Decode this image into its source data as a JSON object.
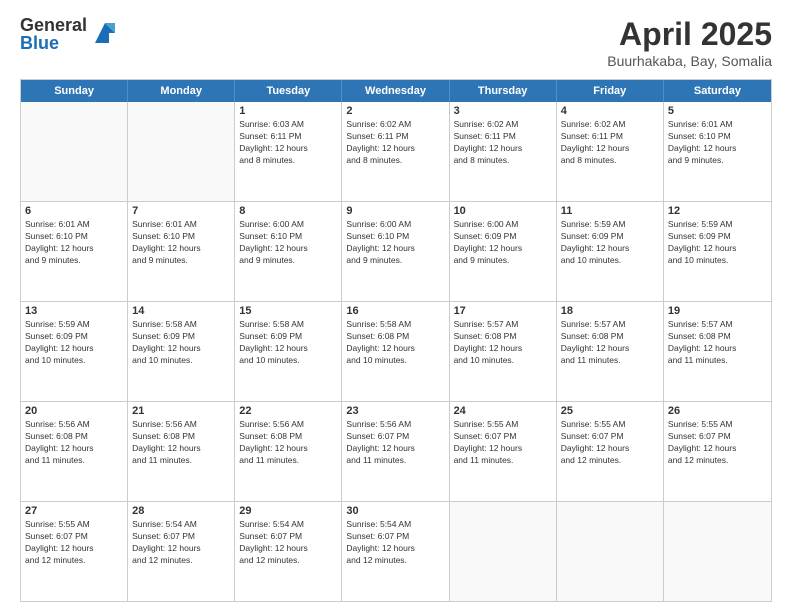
{
  "logo": {
    "general": "General",
    "blue": "Blue"
  },
  "title": "April 2025",
  "subtitle": "Buurhakaba, Bay, Somalia",
  "header_days": [
    "Sunday",
    "Monday",
    "Tuesday",
    "Wednesday",
    "Thursday",
    "Friday",
    "Saturday"
  ],
  "rows": [
    [
      {
        "day": "",
        "lines": []
      },
      {
        "day": "",
        "lines": []
      },
      {
        "day": "1",
        "lines": [
          "Sunrise: 6:03 AM",
          "Sunset: 6:11 PM",
          "Daylight: 12 hours",
          "and 8 minutes."
        ]
      },
      {
        "day": "2",
        "lines": [
          "Sunrise: 6:02 AM",
          "Sunset: 6:11 PM",
          "Daylight: 12 hours",
          "and 8 minutes."
        ]
      },
      {
        "day": "3",
        "lines": [
          "Sunrise: 6:02 AM",
          "Sunset: 6:11 PM",
          "Daylight: 12 hours",
          "and 8 minutes."
        ]
      },
      {
        "day": "4",
        "lines": [
          "Sunrise: 6:02 AM",
          "Sunset: 6:11 PM",
          "Daylight: 12 hours",
          "and 8 minutes."
        ]
      },
      {
        "day": "5",
        "lines": [
          "Sunrise: 6:01 AM",
          "Sunset: 6:10 PM",
          "Daylight: 12 hours",
          "and 9 minutes."
        ]
      }
    ],
    [
      {
        "day": "6",
        "lines": [
          "Sunrise: 6:01 AM",
          "Sunset: 6:10 PM",
          "Daylight: 12 hours",
          "and 9 minutes."
        ]
      },
      {
        "day": "7",
        "lines": [
          "Sunrise: 6:01 AM",
          "Sunset: 6:10 PM",
          "Daylight: 12 hours",
          "and 9 minutes."
        ]
      },
      {
        "day": "8",
        "lines": [
          "Sunrise: 6:00 AM",
          "Sunset: 6:10 PM",
          "Daylight: 12 hours",
          "and 9 minutes."
        ]
      },
      {
        "day": "9",
        "lines": [
          "Sunrise: 6:00 AM",
          "Sunset: 6:10 PM",
          "Daylight: 12 hours",
          "and 9 minutes."
        ]
      },
      {
        "day": "10",
        "lines": [
          "Sunrise: 6:00 AM",
          "Sunset: 6:09 PM",
          "Daylight: 12 hours",
          "and 9 minutes."
        ]
      },
      {
        "day": "11",
        "lines": [
          "Sunrise: 5:59 AM",
          "Sunset: 6:09 PM",
          "Daylight: 12 hours",
          "and 10 minutes."
        ]
      },
      {
        "day": "12",
        "lines": [
          "Sunrise: 5:59 AM",
          "Sunset: 6:09 PM",
          "Daylight: 12 hours",
          "and 10 minutes."
        ]
      }
    ],
    [
      {
        "day": "13",
        "lines": [
          "Sunrise: 5:59 AM",
          "Sunset: 6:09 PM",
          "Daylight: 12 hours",
          "and 10 minutes."
        ]
      },
      {
        "day": "14",
        "lines": [
          "Sunrise: 5:58 AM",
          "Sunset: 6:09 PM",
          "Daylight: 12 hours",
          "and 10 minutes."
        ]
      },
      {
        "day": "15",
        "lines": [
          "Sunrise: 5:58 AM",
          "Sunset: 6:09 PM",
          "Daylight: 12 hours",
          "and 10 minutes."
        ]
      },
      {
        "day": "16",
        "lines": [
          "Sunrise: 5:58 AM",
          "Sunset: 6:08 PM",
          "Daylight: 12 hours",
          "and 10 minutes."
        ]
      },
      {
        "day": "17",
        "lines": [
          "Sunrise: 5:57 AM",
          "Sunset: 6:08 PM",
          "Daylight: 12 hours",
          "and 10 minutes."
        ]
      },
      {
        "day": "18",
        "lines": [
          "Sunrise: 5:57 AM",
          "Sunset: 6:08 PM",
          "Daylight: 12 hours",
          "and 11 minutes."
        ]
      },
      {
        "day": "19",
        "lines": [
          "Sunrise: 5:57 AM",
          "Sunset: 6:08 PM",
          "Daylight: 12 hours",
          "and 11 minutes."
        ]
      }
    ],
    [
      {
        "day": "20",
        "lines": [
          "Sunrise: 5:56 AM",
          "Sunset: 6:08 PM",
          "Daylight: 12 hours",
          "and 11 minutes."
        ]
      },
      {
        "day": "21",
        "lines": [
          "Sunrise: 5:56 AM",
          "Sunset: 6:08 PM",
          "Daylight: 12 hours",
          "and 11 minutes."
        ]
      },
      {
        "day": "22",
        "lines": [
          "Sunrise: 5:56 AM",
          "Sunset: 6:08 PM",
          "Daylight: 12 hours",
          "and 11 minutes."
        ]
      },
      {
        "day": "23",
        "lines": [
          "Sunrise: 5:56 AM",
          "Sunset: 6:07 PM",
          "Daylight: 12 hours",
          "and 11 minutes."
        ]
      },
      {
        "day": "24",
        "lines": [
          "Sunrise: 5:55 AM",
          "Sunset: 6:07 PM",
          "Daylight: 12 hours",
          "and 11 minutes."
        ]
      },
      {
        "day": "25",
        "lines": [
          "Sunrise: 5:55 AM",
          "Sunset: 6:07 PM",
          "Daylight: 12 hours",
          "and 12 minutes."
        ]
      },
      {
        "day": "26",
        "lines": [
          "Sunrise: 5:55 AM",
          "Sunset: 6:07 PM",
          "Daylight: 12 hours",
          "and 12 minutes."
        ]
      }
    ],
    [
      {
        "day": "27",
        "lines": [
          "Sunrise: 5:55 AM",
          "Sunset: 6:07 PM",
          "Daylight: 12 hours",
          "and 12 minutes."
        ]
      },
      {
        "day": "28",
        "lines": [
          "Sunrise: 5:54 AM",
          "Sunset: 6:07 PM",
          "Daylight: 12 hours",
          "and 12 minutes."
        ]
      },
      {
        "day": "29",
        "lines": [
          "Sunrise: 5:54 AM",
          "Sunset: 6:07 PM",
          "Daylight: 12 hours",
          "and 12 minutes."
        ]
      },
      {
        "day": "30",
        "lines": [
          "Sunrise: 5:54 AM",
          "Sunset: 6:07 PM",
          "Daylight: 12 hours",
          "and 12 minutes."
        ]
      },
      {
        "day": "",
        "lines": []
      },
      {
        "day": "",
        "lines": []
      },
      {
        "day": "",
        "lines": []
      }
    ]
  ]
}
